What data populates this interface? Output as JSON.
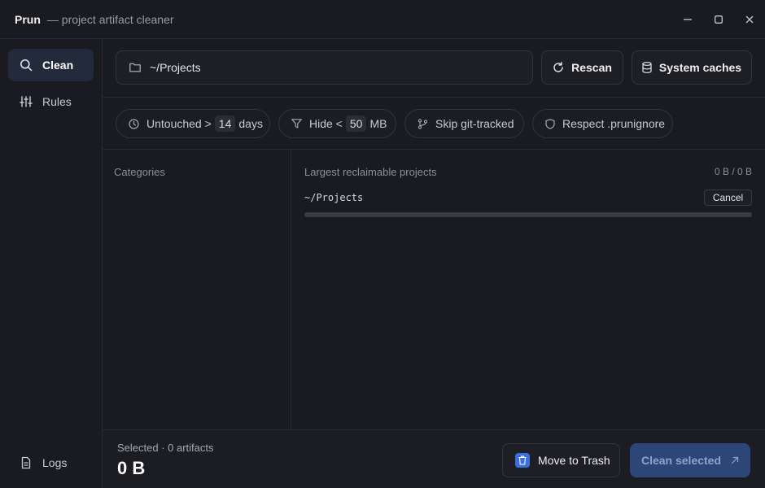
{
  "window": {
    "app_name": "Prun",
    "subtitle": "— project artifact cleaner"
  },
  "sidebar": {
    "items": [
      {
        "label": "Clean",
        "icon": "search-icon",
        "active": true
      },
      {
        "label": "Rules",
        "icon": "sliders-icon",
        "active": false
      },
      {
        "label": "Logs",
        "icon": "document-icon",
        "active": false
      }
    ]
  },
  "toolbar": {
    "path_value": "~/Projects",
    "rescan_label": "Rescan",
    "system_caches_label": "System caches"
  },
  "filters": {
    "untouched_prefix": "Untouched >",
    "untouched_days": "14",
    "untouched_suffix": "days",
    "hide_prefix": "Hide <",
    "hide_size": "50",
    "hide_suffix": "MB",
    "skip_git_label": "Skip git-tracked",
    "respect_label": "Respect .prunignore"
  },
  "categories": {
    "header": "Categories"
  },
  "projects": {
    "header": "Largest reclaimable projects",
    "size_total": "0 B / 0 B",
    "scanning_path": "~/Projects",
    "cancel_label": "Cancel",
    "progress": 0
  },
  "footer": {
    "selected_label": "Selected · 0 artifacts",
    "selected_size": "0 B",
    "trash_label": "Move to Trash",
    "clean_label": "Clean selected"
  },
  "colors": {
    "accent": "#3b6fe0",
    "clean_button": "#2d4678",
    "active_nav": "#222a3b"
  }
}
